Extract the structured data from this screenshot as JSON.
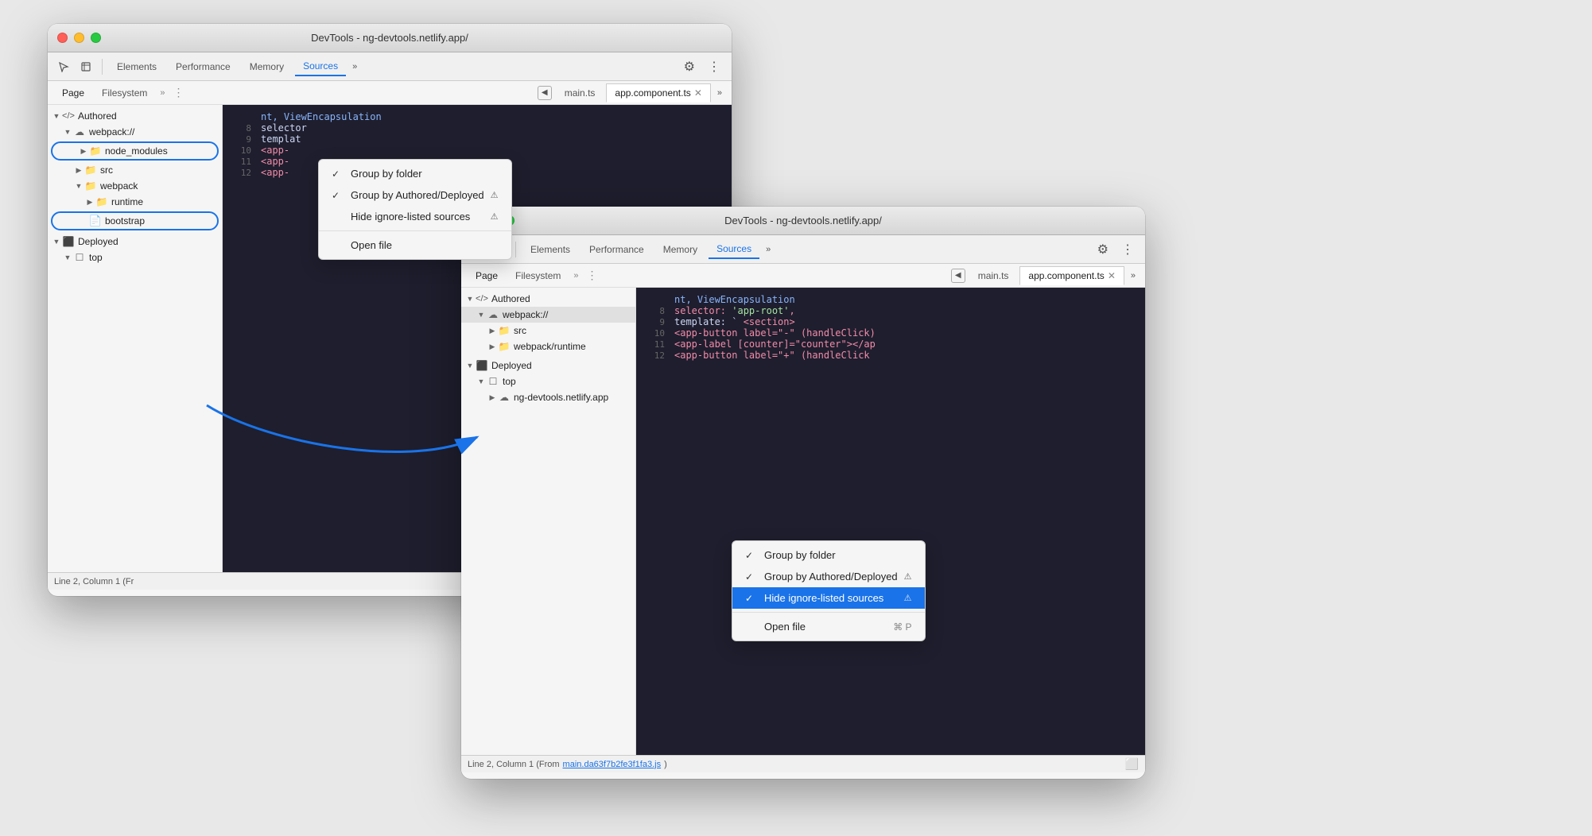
{
  "window1": {
    "title": "DevTools - ng-devtools.netlify.app/",
    "tabs": [
      "Elements",
      "Performance",
      "Memory",
      "Sources"
    ],
    "active_tab": "Sources",
    "sub_tabs": [
      "Page",
      "Filesystem"
    ],
    "editor_tabs": [
      "main.ts",
      "app.component.ts"
    ],
    "active_editor_tab": "app.component.ts",
    "sidebar_tree": [
      {
        "label": "Authored",
        "icon": "code",
        "indent": 0,
        "expanded": true,
        "toggle": "▼"
      },
      {
        "label": "webpack://",
        "icon": "cloud",
        "indent": 1,
        "expanded": true,
        "toggle": "▼"
      },
      {
        "label": "node_modules",
        "icon": "folder-orange",
        "indent": 2,
        "expanded": false,
        "toggle": "▶",
        "highlighted": true
      },
      {
        "label": "src",
        "icon": "folder-orange",
        "indent": 2,
        "expanded": false,
        "toggle": "▶"
      },
      {
        "label": "webpack",
        "icon": "folder-orange",
        "indent": 2,
        "expanded": true,
        "toggle": "▼"
      },
      {
        "label": "runtime",
        "icon": "folder-orange",
        "indent": 3,
        "expanded": false,
        "toggle": "▶"
      },
      {
        "label": "bootstrap",
        "icon": "file",
        "indent": 3,
        "expanded": false,
        "toggle": "",
        "highlighted": true
      },
      {
        "label": "Deployed",
        "icon": "cube",
        "indent": 0,
        "expanded": true,
        "toggle": "▼"
      },
      {
        "label": "top",
        "icon": "square",
        "indent": 1,
        "expanded": false,
        "toggle": "▼"
      }
    ],
    "context_menu": {
      "visible": true,
      "items": [
        {
          "label": "Group by folder",
          "checked": true,
          "shortcut": ""
        },
        {
          "label": "Group by Authored/Deployed",
          "checked": true,
          "shortcut": "",
          "warn": true
        },
        {
          "label": "Hide ignore-listed sources",
          "checked": false,
          "shortcut": "",
          "warn": true
        },
        {
          "divider": true
        },
        {
          "label": "Open file",
          "checked": false,
          "shortcut": ""
        }
      ]
    },
    "code_lines": [
      {
        "num": "",
        "text": "nt, ViewEncapsulation",
        "classes": [
          "code-blue"
        ]
      },
      {
        "num": "",
        "text": "",
        "classes": []
      },
      {
        "num": "8",
        "text": "selector",
        "classes": [
          "code-text"
        ]
      },
      {
        "num": "9",
        "text": "templat",
        "classes": [
          "code-text"
        ]
      },
      {
        "num": "10",
        "text": "  <app-",
        "classes": [
          "code-red"
        ]
      },
      {
        "num": "11",
        "text": "  <app-",
        "classes": [
          "code-red"
        ]
      },
      {
        "num": "12",
        "text": "  <app-",
        "classes": [
          "code-red"
        ]
      }
    ],
    "status": "Line 2, Column 1 (Fr"
  },
  "window2": {
    "title": "DevTools - ng-devtools.netlify.app/",
    "tabs": [
      "Elements",
      "Performance",
      "Memory",
      "Sources"
    ],
    "active_tab": "Sources",
    "sub_tabs": [
      "Page",
      "Filesystem"
    ],
    "editor_tabs": [
      "main.ts",
      "app.component.ts"
    ],
    "active_editor_tab": "app.component.ts",
    "sidebar_tree": [
      {
        "label": "Authored",
        "icon": "code",
        "indent": 0,
        "expanded": true,
        "toggle": "▼"
      },
      {
        "label": "webpack://",
        "icon": "cloud",
        "indent": 1,
        "expanded": true,
        "toggle": "▼"
      },
      {
        "label": "src",
        "icon": "folder-orange",
        "indent": 2,
        "expanded": false,
        "toggle": "▶"
      },
      {
        "label": "webpack/runtime",
        "icon": "folder-orange",
        "indent": 2,
        "expanded": false,
        "toggle": "▶"
      },
      {
        "label": "Deployed",
        "icon": "cube",
        "indent": 0,
        "expanded": true,
        "toggle": "▼"
      },
      {
        "label": "top",
        "icon": "square",
        "indent": 1,
        "expanded": true,
        "toggle": "▼"
      },
      {
        "label": "ng-devtools.netlify.app",
        "icon": "cloud",
        "indent": 2,
        "expanded": false,
        "toggle": "▶"
      }
    ],
    "context_menu": {
      "visible": true,
      "items": [
        {
          "label": "Group by folder",
          "checked": true,
          "shortcut": ""
        },
        {
          "label": "Group by Authored/Deployed",
          "checked": true,
          "shortcut": "",
          "warn": true
        },
        {
          "label": "Hide ignore-listed sources",
          "checked": true,
          "shortcut": "",
          "warn": true,
          "selected": true
        },
        {
          "divider": true
        },
        {
          "label": "Open file",
          "checked": false,
          "shortcut": "⌘ P"
        }
      ]
    },
    "code_lines": [
      {
        "num": "",
        "text": "nt, ViewEncapsulation",
        "class": "code-blue"
      },
      {
        "num": "8",
        "text": "selector: 'app-root',",
        "class": "code-text"
      },
      {
        "num": "9",
        "text": "template: `<section>",
        "class": "code-text"
      },
      {
        "num": "10",
        "text": "  <app-button label=\"-\" (handleClick)",
        "class": "code-red"
      },
      {
        "num": "11",
        "text": "  <app-label [counter]=\"counter\"></ap",
        "class": "code-red"
      },
      {
        "num": "12",
        "text": "  <app-button label=\"+\" (handleClick",
        "class": "code-red"
      }
    ],
    "status": "Line 2, Column 1 (From main.da63f7b2fe3f1fa3.js)"
  },
  "icons": {
    "close": "✕",
    "chevron_right": "›",
    "chevron_down": "⌄",
    "chevron_double": "»",
    "gear": "⚙",
    "more": "⋮",
    "back": "‹",
    "forward": "›",
    "warn": "⚠",
    "check": "✓",
    "folder": "📁",
    "file": "📄"
  }
}
